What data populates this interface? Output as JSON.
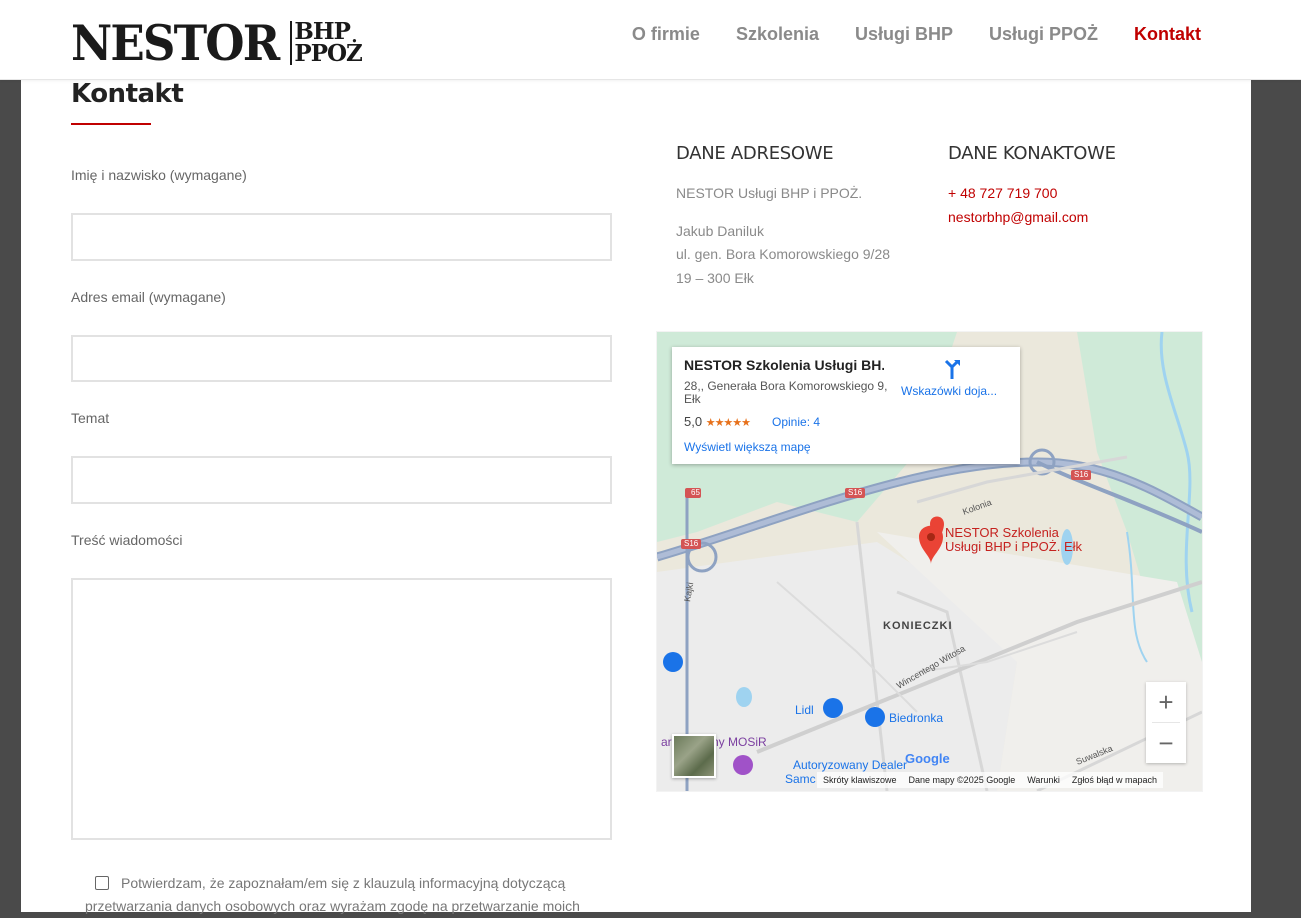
{
  "header": {
    "logo": {
      "main": "NESTOR",
      "line1": "BHP",
      "line2": "PPOŻ"
    },
    "nav": [
      {
        "label": "O firmie",
        "active": false
      },
      {
        "label": "Szkolenia",
        "active": false
      },
      {
        "label": "Usługi BHP",
        "active": false
      },
      {
        "label": "Usługi PPOŻ",
        "active": false
      },
      {
        "label": "Kontakt",
        "active": true
      }
    ]
  },
  "page": {
    "title": "Kontakt"
  },
  "form": {
    "name_label": "Imię i nazwisko (wymagane)",
    "email_label": "Adres email (wymagane)",
    "subject_label": "Temat",
    "message_label": "Treść wiadomości",
    "name_value": "",
    "email_value": "",
    "subject_value": "",
    "message_value": "",
    "consent_text": "Potwierdzam, że zapoznałam/em się z klauzulą informacyjną dotyczącą przetwarzania danych osobowych oraz wyrażam zgodę na przetwarzanie moich",
    "consent_checked": false
  },
  "address": {
    "heading": "DANE ADRESOWE",
    "company": "NESTOR Usługi BHP i PPOŻ.",
    "person": "Jakub Daniluk",
    "street": "ul. gen. Bora Komorowskiego 9/28",
    "city": "19 – 300 Ełk"
  },
  "contact": {
    "heading": "DANE KONAKTOWE",
    "phone": "+ 48 727 719 700",
    "email": "nestorbhp@gmail.com"
  },
  "map": {
    "card": {
      "name": "NESTOR Szkolenia Usługi BH...",
      "address": "28,, Generała Bora Komorowskiego 9, Ełk",
      "rating": "5,0",
      "stars": "★★★★★",
      "reviews": "Opinie: 4",
      "bigger_map": "Wyświetl większą mapę",
      "directions": "Wskazówki doja..."
    },
    "marker_label_1": "NESTOR Szkolenia",
    "marker_label_2": "Usługi BHP i PPOŻ. Ełk",
    "labels": {
      "district": "KONIECZKI",
      "kolonia": "Kolonia",
      "kajki": "Kajki",
      "witosa": "Wincentego Witosa",
      "suwalska": "Suwalska",
      "lidl": "Lidl",
      "biedronka": "Biedronka",
      "mosir": "ny MOSiR",
      "mosir_prefix": "ar",
      "dealer": "Autoryzowany Dealer",
      "samo": "Samc",
      "road_s16": "S16",
      "road_65": "65",
      "google": "Google"
    },
    "zoom_in": "+",
    "zoom_out": "−",
    "footer": {
      "shortcuts": "Skróty klawiszowe",
      "data": "Dane mapy ©2025 Google",
      "terms": "Warunki",
      "report": "Zgłoś błąd w mapach"
    },
    "colors": {
      "marker": "#ea4335",
      "link": "#1a73e8",
      "road": "#8ea2c2",
      "water": "#9fd3f0"
    }
  }
}
